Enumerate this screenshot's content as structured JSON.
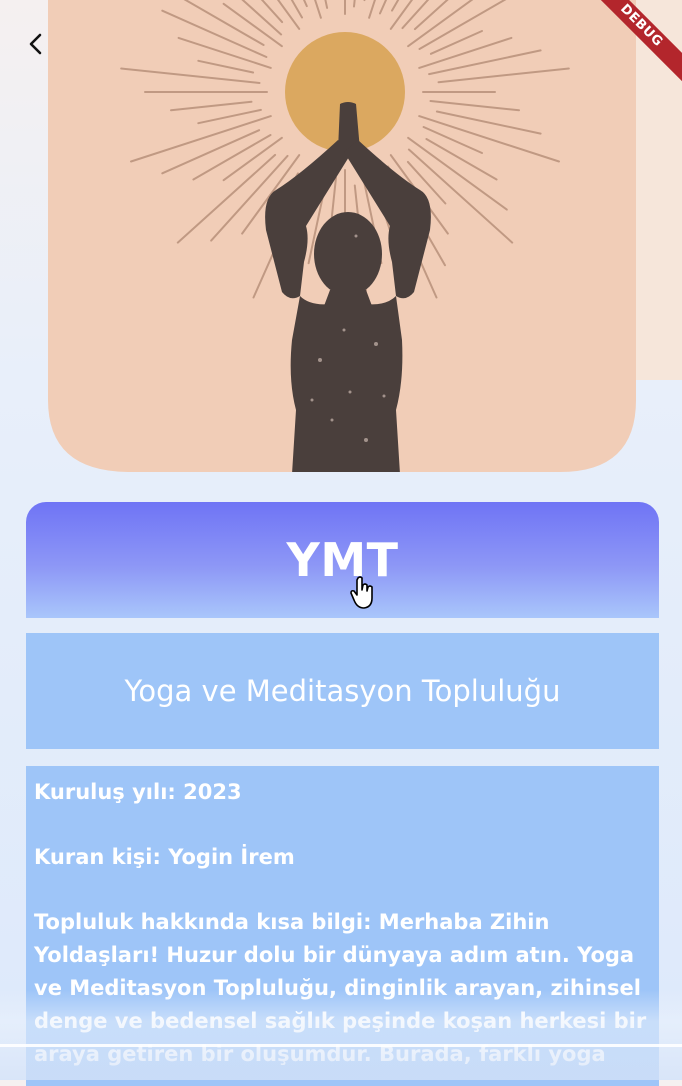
{
  "header": {
    "back_icon": "back-arrow-icon",
    "debug_label": "DEBUG"
  },
  "hero_image": {
    "subject": "meditating figure with raised joined hands before a sun",
    "colors": {
      "background": "#f1cdb7",
      "sun": "#dba860",
      "figure": "#4a3f3c",
      "rays": "#b8917a"
    }
  },
  "community": {
    "abbreviation": "YMT",
    "full_name": "Yoga ve Meditasyon Topluluğu",
    "founded": "Kuruluş yılı: 2023",
    "founder": "Kuran kişi: Yogin İrem",
    "about": "Topluluk hakkında kısa bilgi: Merhaba Zihin Yoldaşları! Huzur dolu bir dünyaya adım atın. Yoga ve Meditasyon Topluluğu, dinginlik arayan, zihinsel denge ve bedensel sağlık peşinde koşan herkesi bir araya getiren bir oluşumdur. Burada, farklı yoga"
  },
  "colors": {
    "title_gradient_top": "#6f74f5",
    "card_blue": "#9ec5f8",
    "text": "#ffffff"
  }
}
